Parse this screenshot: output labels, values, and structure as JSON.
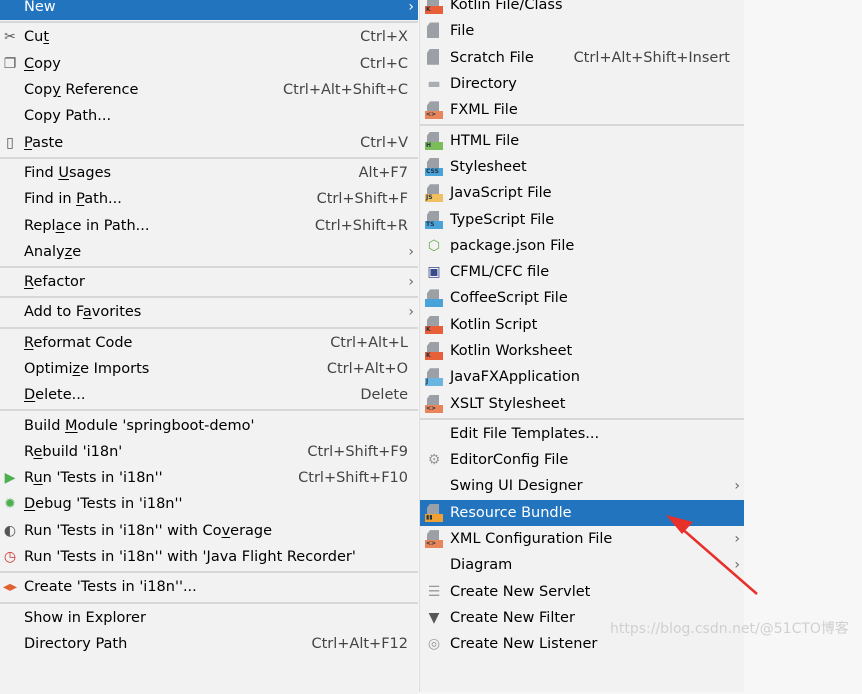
{
  "colors": {
    "highlight": "#2374bf",
    "menu_bg": "#f2f2f2",
    "arrow": "#e8302a"
  },
  "left_menu": [
    {
      "pre": "New",
      "u": "",
      "post": "",
      "shortcut": "",
      "submenu": true,
      "selected": true,
      "icon": ""
    },
    {
      "sep": true
    },
    {
      "pre": "Cu",
      "u": "t",
      "post": "",
      "shortcut": "Ctrl+X",
      "icon": "scissors-icon"
    },
    {
      "pre": "",
      "u": "C",
      "post": "opy",
      "shortcut": "Ctrl+C",
      "icon": "copy-icon"
    },
    {
      "pre": "Cop",
      "u": "y",
      "post": " Reference",
      "shortcut": "Ctrl+Alt+Shift+C",
      "icon": ""
    },
    {
      "pre": "Copy Path...",
      "u": "",
      "post": "",
      "shortcut": "",
      "icon": ""
    },
    {
      "pre": "",
      "u": "P",
      "post": "aste",
      "shortcut": "Ctrl+V",
      "icon": "clipboard-icon"
    },
    {
      "sep": true
    },
    {
      "pre": "Find ",
      "u": "U",
      "post": "sages",
      "shortcut": "Alt+F7",
      "icon": ""
    },
    {
      "pre": "Find in ",
      "u": "P",
      "post": "ath...",
      "shortcut": "Ctrl+Shift+F",
      "icon": ""
    },
    {
      "pre": "Repl",
      "u": "a",
      "post": "ce in Path...",
      "shortcut": "Ctrl+Shift+R",
      "icon": ""
    },
    {
      "pre": "Analy",
      "u": "z",
      "post": "e",
      "shortcut": "",
      "submenu": true,
      "icon": ""
    },
    {
      "sep": true
    },
    {
      "pre": "",
      "u": "R",
      "post": "efactor",
      "shortcut": "",
      "submenu": true,
      "icon": ""
    },
    {
      "sep": true
    },
    {
      "pre": "Add to F",
      "u": "a",
      "post": "vorites",
      "shortcut": "",
      "submenu": true,
      "icon": ""
    },
    {
      "sep": true
    },
    {
      "pre": "",
      "u": "R",
      "post": "eformat Code",
      "shortcut": "Ctrl+Alt+L",
      "icon": ""
    },
    {
      "pre": "Optimi",
      "u": "z",
      "post": "e Imports",
      "shortcut": "Ctrl+Alt+O",
      "icon": ""
    },
    {
      "pre": "",
      "u": "D",
      "post": "elete...",
      "shortcut": "Delete",
      "icon": ""
    },
    {
      "sep": true
    },
    {
      "pre": "Build ",
      "u": "M",
      "post": "odule 'springboot-demo'",
      "shortcut": "",
      "icon": ""
    },
    {
      "pre": "R",
      "u": "e",
      "post": "build 'i18n'",
      "shortcut": "Ctrl+Shift+F9",
      "icon": ""
    },
    {
      "pre": "R",
      "u": "u",
      "post": "n 'Tests in 'i18n''",
      "shortcut": "Ctrl+Shift+F10",
      "icon": "run-icon"
    },
    {
      "pre": "",
      "u": "D",
      "post": "ebug 'Tests in 'i18n''",
      "shortcut": "",
      "icon": "debug-icon"
    },
    {
      "pre": "Run 'Tests in 'i18n'' with Co",
      "u": "v",
      "post": "erage",
      "shortcut": "",
      "icon": "coverage-icon"
    },
    {
      "pre": "Run 'Tests in 'i18n'' with 'Java Flight Recorder'",
      "u": "",
      "post": "",
      "shortcut": "",
      "icon": "profiler-icon"
    },
    {
      "sep": true
    },
    {
      "pre": "Create 'Tests in 'i18n''...",
      "u": "",
      "post": "",
      "shortcut": "",
      "icon": "create-test-icon"
    },
    {
      "sep": true
    },
    {
      "pre": "Show in Explorer",
      "u": "",
      "post": "",
      "shortcut": "",
      "icon": ""
    },
    {
      "pre": "Directory Path",
      "u": "",
      "post": "",
      "shortcut": "Ctrl+Alt+F12",
      "icon": ""
    }
  ],
  "new_submenu": [
    {
      "label": "Kotlin File/Class",
      "shortcut": "",
      "icon": "kotlin-file-icon"
    },
    {
      "label": "File",
      "shortcut": "",
      "icon": "file-icon"
    },
    {
      "label": "Scratch File",
      "shortcut": "Ctrl+Alt+Shift+Insert",
      "icon": "scratch-file-icon"
    },
    {
      "label": "Directory",
      "shortcut": "",
      "icon": "folder-icon"
    },
    {
      "label": "FXML File",
      "shortcut": "",
      "icon": "fxml-file-icon"
    },
    {
      "sep": true
    },
    {
      "label": "HTML File",
      "shortcut": "",
      "icon": "html-file-icon"
    },
    {
      "label": "Stylesheet",
      "shortcut": "",
      "icon": "css-file-icon"
    },
    {
      "label": "JavaScript File",
      "shortcut": "",
      "icon": "js-file-icon"
    },
    {
      "label": "TypeScript File",
      "shortcut": "",
      "icon": "ts-file-icon"
    },
    {
      "label": "package.json File",
      "shortcut": "",
      "icon": "nodejs-icon"
    },
    {
      "label": "CFML/CFC file",
      "shortcut": "",
      "icon": "cfml-icon"
    },
    {
      "label": "CoffeeScript File",
      "shortcut": "",
      "icon": "coffeescript-icon"
    },
    {
      "label": "Kotlin Script",
      "shortcut": "",
      "icon": "kotlin-script-icon"
    },
    {
      "label": "Kotlin Worksheet",
      "shortcut": "",
      "icon": "kotlin-worksheet-icon"
    },
    {
      "label": "JavaFXApplication",
      "shortcut": "",
      "icon": "javafx-icon"
    },
    {
      "label": "XSLT Stylesheet",
      "shortcut": "",
      "icon": "xslt-file-icon"
    },
    {
      "sep": true
    },
    {
      "label": "Edit File Templates...",
      "shortcut": "",
      "icon": ""
    },
    {
      "label": "EditorConfig File",
      "shortcut": "",
      "icon": "gear-icon"
    },
    {
      "label": "Swing UI Designer",
      "shortcut": "",
      "submenu": true,
      "icon": ""
    },
    {
      "label": "Resource Bundle",
      "shortcut": "",
      "selected": true,
      "icon": "resource-bundle-icon"
    },
    {
      "label": "XML Configuration File",
      "shortcut": "",
      "submenu": true,
      "icon": "xml-file-icon"
    },
    {
      "label": "Diagram",
      "shortcut": "",
      "submenu": true,
      "icon": ""
    },
    {
      "label": "Create New Servlet",
      "shortcut": "",
      "icon": "servlet-icon"
    },
    {
      "label": "Create New Filter",
      "shortcut": "",
      "icon": "filter-icon"
    },
    {
      "label": "Create New Listener",
      "shortcut": "",
      "icon": "listener-icon"
    }
  ],
  "submenu_arrow": "›",
  "watermark": "https://blog.csdn.net/@51CTO博客"
}
